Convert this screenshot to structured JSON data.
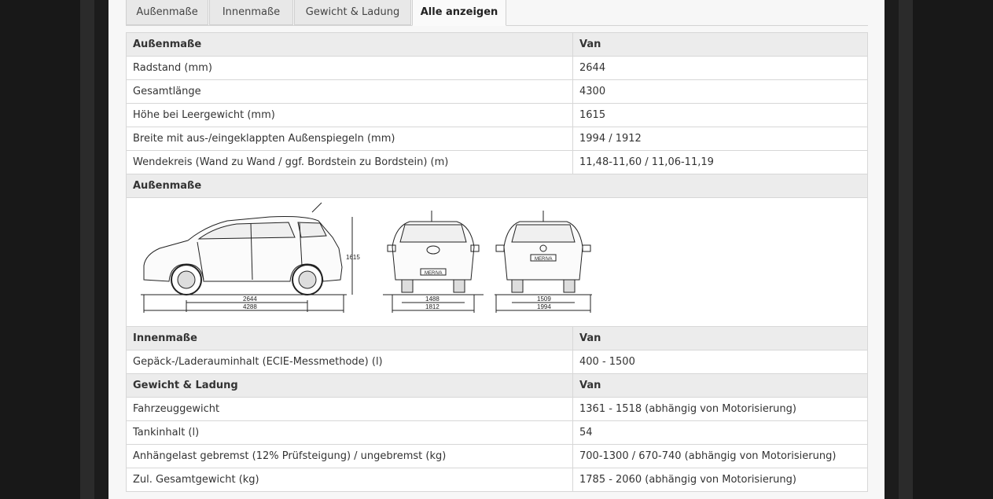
{
  "tabs": [
    {
      "label": "Außenmaße",
      "active": false
    },
    {
      "label": "Innenmaße",
      "active": false
    },
    {
      "label": "Gewicht & Ladung",
      "active": false
    },
    {
      "label": "Alle anzeigen",
      "active": true
    }
  ],
  "exterior": {
    "header": "Außenmaße",
    "column": "Van",
    "rows": [
      {
        "label": "Radstand (mm)",
        "value": "2644"
      },
      {
        "label": "Gesamtlänge",
        "value": "4300"
      },
      {
        "label": "Höhe bei Leergewicht (mm)",
        "value": "1615"
      },
      {
        "label": "Breite mit aus-/eingeklappten Außenspiegeln (mm)",
        "value": "1994 / 1912"
      },
      {
        "label": "Wendekreis (Wand zu Wand / ggf. Bordstein zu Bordstein) (m)",
        "value": "11,48-11,60 / 11,06-11,19"
      }
    ]
  },
  "diagram": {
    "header": "Außenmaße",
    "side": {
      "height": "1615",
      "wheelbase": "2644",
      "length": "4288"
    },
    "front": {
      "track": "1488",
      "width": "1812",
      "badge": "MERIVA"
    },
    "rear": {
      "track": "1509",
      "width": "1994",
      "badge": "MERIVA"
    }
  },
  "interior": {
    "header": "Innenmaße",
    "column": "Van",
    "rows": [
      {
        "label": "Gepäck-/Laderauminhalt (ECIE-Messmethode) (l)",
        "value": "400 - 1500"
      }
    ]
  },
  "weight": {
    "header": "Gewicht & Ladung",
    "column": "Van",
    "rows": [
      {
        "label": "Fahrzeuggewicht",
        "value": "1361 - 1518 (abhängig von Motorisierung)"
      },
      {
        "label": "Tankinhalt (l)",
        "value": "54"
      },
      {
        "label": "Anhängelast gebremst (12% Prüfsteigung) / ungebremst (kg)",
        "value": "700-1300 / 670-740 (abhängig von Motorisierung)"
      },
      {
        "label": "Zul. Gesamtgewicht (kg)",
        "value": "1785 - 2060 (abhängig von Motorisierung)"
      }
    ]
  }
}
